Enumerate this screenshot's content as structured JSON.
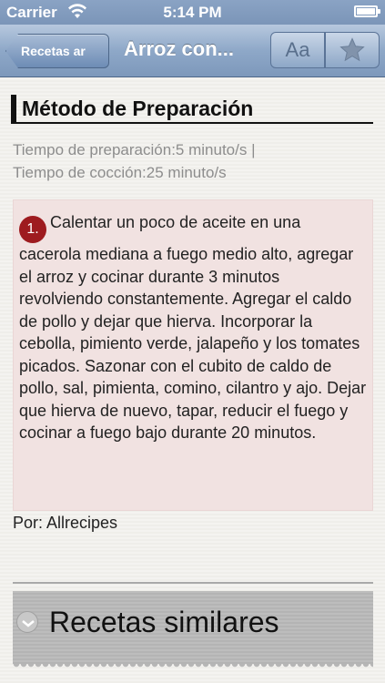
{
  "status_bar": {
    "carrier": "Carrier",
    "time": "5:14 PM",
    "wifi_icon": "wifi-icon",
    "battery_icon": "battery-icon"
  },
  "nav": {
    "back_label": "Recetas ar",
    "title": "Arroz con...",
    "font_button_label": "Aa",
    "favorite_icon": "star-icon"
  },
  "section": {
    "heading": "Método de Preparación",
    "prep_time": "Tiempo de preparación:5 minuto/s |",
    "cook_time": "Tiempo de cocción:25 minuto/s"
  },
  "steps": [
    {
      "number": "1.",
      "text": "Calentar un poco de aceite en una cacerola mediana a fuego medio alto, agregar el arroz y cocinar durante 3 minutos revolviendo constantemente. Agregar el caldo de pollo y dejar que hierva. Incorporar la cebolla, pimiento verde, jalapeño y los tomates picados. Sazonar con el cubito de caldo de pollo, sal, pimienta, comino, cilantro y ajo. Dejar que hierva de nuevo, tapar, reducir el fuego y cocinar a fuego bajo durante 20 minutos."
    }
  ],
  "author": "Por: Allrecipes",
  "similar": {
    "label": "Recetas similares"
  },
  "colors": {
    "nav_bar": "#8ea8c8",
    "step_background": "#f1e2e1",
    "step_number_badge": "#9e1b1f"
  }
}
